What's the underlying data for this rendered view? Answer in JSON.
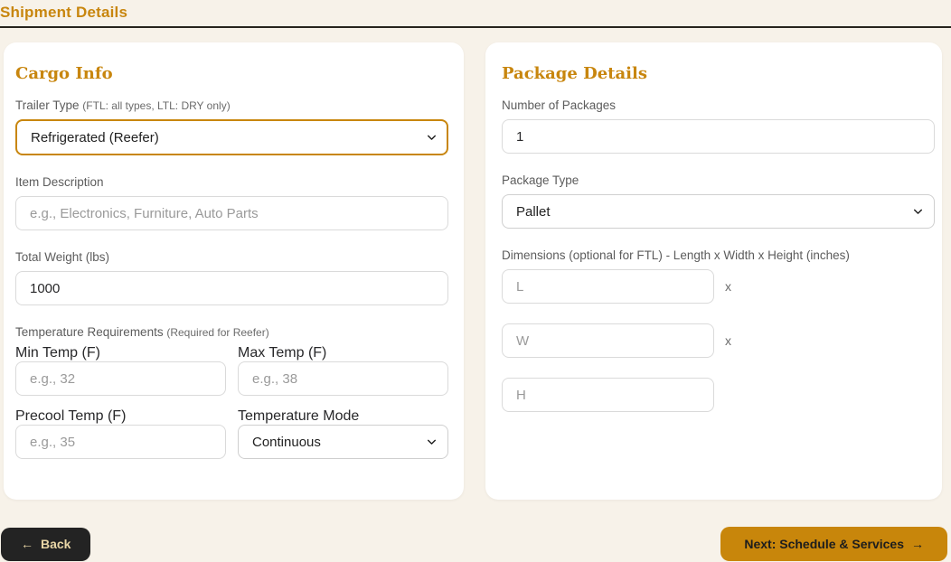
{
  "page": {
    "title": "Shipment Details"
  },
  "colors": {
    "accent_gold": "#c8860e",
    "dark": "#232323",
    "page_bg": "#f7f2e9"
  },
  "cargo": {
    "heading": "Cargo Info",
    "trailer_type": {
      "label": "Trailer Type",
      "note": "(FTL: all types, LTL: DRY only)",
      "value": "Refrigerated (Reefer)"
    },
    "item_description": {
      "label": "Item Description",
      "placeholder": "e.g., Electronics, Furniture, Auto Parts"
    },
    "total_weight": {
      "label": "Total Weight (lbs)",
      "value": "1000"
    },
    "temperature": {
      "label": "Temperature Requirements",
      "note": "(Required for Reefer)",
      "min": {
        "label": "Min Temp (F)",
        "placeholder": "e.g., 32"
      },
      "max": {
        "label": "Max Temp (F)",
        "placeholder": "e.g., 38"
      },
      "precool": {
        "label": "Precool Temp (F)",
        "placeholder": "e.g., 35"
      },
      "mode": {
        "label": "Temperature Mode",
        "value": "Continuous"
      }
    }
  },
  "package": {
    "heading": "Package Details",
    "number": {
      "label": "Number of Packages",
      "value": "1"
    },
    "type": {
      "label": "Package Type",
      "value": "Pallet"
    },
    "dimensions": {
      "label": "Dimensions (optional for FTL) - Length x Width x Height (inches)",
      "length_placeholder": "L",
      "width_placeholder": "W",
      "height_placeholder": "H",
      "separator": "x"
    }
  },
  "footer": {
    "back": {
      "icon": "←",
      "label": "Back"
    },
    "next": {
      "label": "Next: Schedule & Services",
      "icon": "→"
    }
  }
}
